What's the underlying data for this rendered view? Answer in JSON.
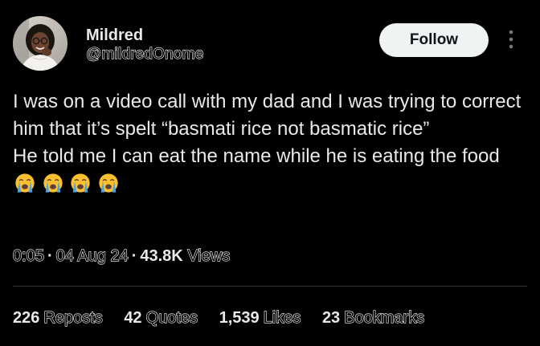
{
  "author": {
    "display_name": "Mildred",
    "handle": "@mildredOnome",
    "avatar": "profile-photo"
  },
  "actions": {
    "follow_label": "Follow",
    "more_icon": "more-options-icon"
  },
  "tweet": {
    "line1": "I was on a video call with my dad and I was trying to correct him that it’s spelt “basmati rice not basmatic rice”",
    "line2_text": "He told me I can eat the name while he is eating the food",
    "emoji": [
      "loudly-crying-face",
      "loudly-crying-face",
      "loudly-crying-face",
      "loudly-crying-face"
    ]
  },
  "meta": {
    "time": "0:05",
    "date": "04 Aug 24",
    "views_count": "43.8K",
    "views_label": "Views"
  },
  "stats": {
    "reposts_count": "226",
    "reposts_label": "Reposts",
    "quotes_count": "42",
    "quotes_label": "Quotes",
    "likes_count": "1,539",
    "likes_label": "Likes",
    "bookmarks_count": "23",
    "bookmarks_label": "Bookmarks"
  },
  "colors": {
    "background": "#000000",
    "text": "#e7e9ea",
    "button_bg": "#eff3f4",
    "divider": "#2f3336",
    "emoji_face": "#fbc02d",
    "emoji_tears": "#4fa3e0"
  }
}
